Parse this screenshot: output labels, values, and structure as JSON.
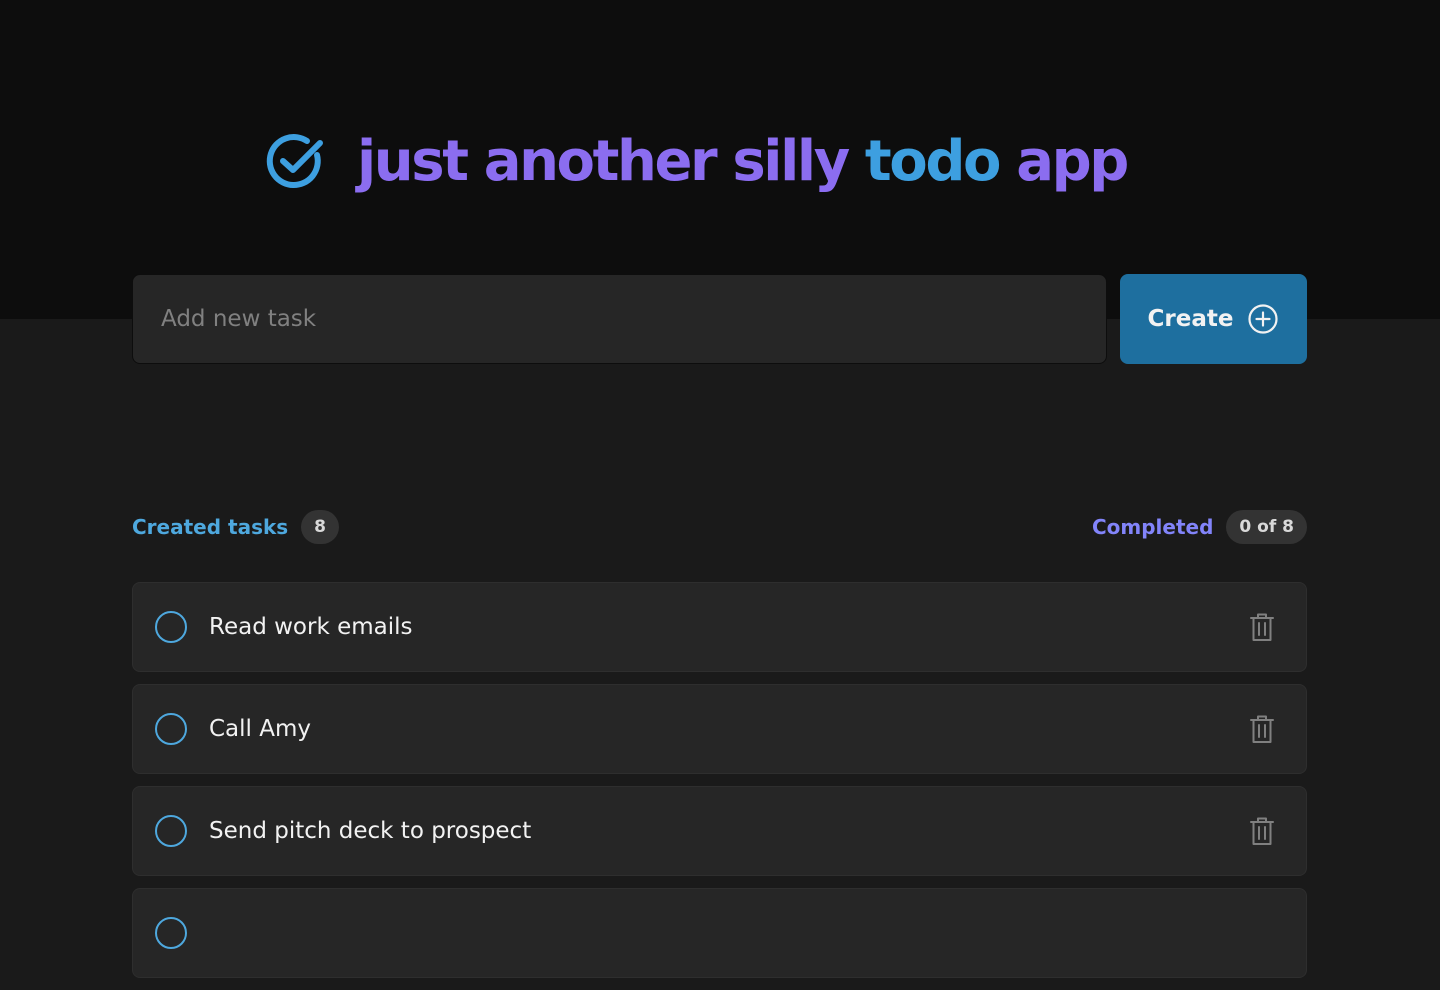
{
  "app": {
    "title_words": [
      "just",
      "another",
      "silly",
      "todo",
      "app"
    ],
    "colors": {
      "title_purple": "#8b6df0",
      "title_blue": "#3d9fe0",
      "accent_blue": "#4ea8de",
      "accent_purple": "#8284fa",
      "create_button": "#1e6f9f"
    }
  },
  "new_task": {
    "placeholder": "Add new task",
    "value": ""
  },
  "create_button": {
    "label": "Create",
    "icon": "plus-circle-icon"
  },
  "stats": {
    "created_label": "Created tasks",
    "created_count": "8",
    "completed_label": "Completed",
    "completed_count": "0 of 8"
  },
  "tasks": [
    {
      "text": "Read work emails",
      "completed": false
    },
    {
      "text": "Call Amy",
      "completed": false
    },
    {
      "text": "Send pitch deck to prospect",
      "completed": false
    },
    {
      "text": "",
      "completed": false
    }
  ]
}
